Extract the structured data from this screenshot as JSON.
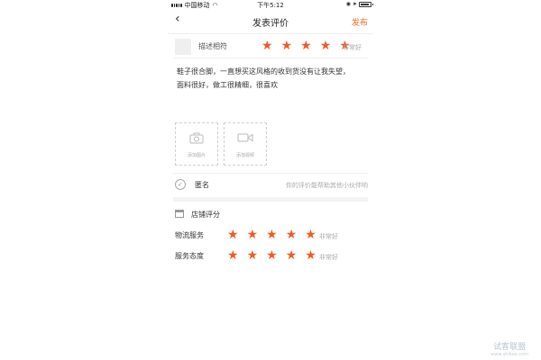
{
  "status_bar": {
    "carrier": "中国移动",
    "time": "下午5:12"
  },
  "nav": {
    "title": "发表评价",
    "publish_label": "发布"
  },
  "description_rating": {
    "label": "描述相符",
    "stars": 5,
    "text": "非常好"
  },
  "review": {
    "line1": "鞋子很合脚，一直想买这风格的收到货没有让我失望，",
    "line2": "面料很好，做工很精细，很喜欢"
  },
  "media": {
    "add_photo_label": "添加图片",
    "add_video_label": "添加视频"
  },
  "anonymous": {
    "label": "匿名",
    "hint": "你的评价能帮助其他小伙伴哟"
  },
  "shop_rating": {
    "title": "店铺评分",
    "items": [
      {
        "label": "物流服务",
        "stars": 5,
        "text": "非常好"
      },
      {
        "label": "服务态度",
        "stars": 5,
        "text": "非常好"
      }
    ]
  },
  "watermark": {
    "name": "试客联盟",
    "url": "www.shikee.com"
  },
  "colors": {
    "accent": "#f15a24"
  }
}
